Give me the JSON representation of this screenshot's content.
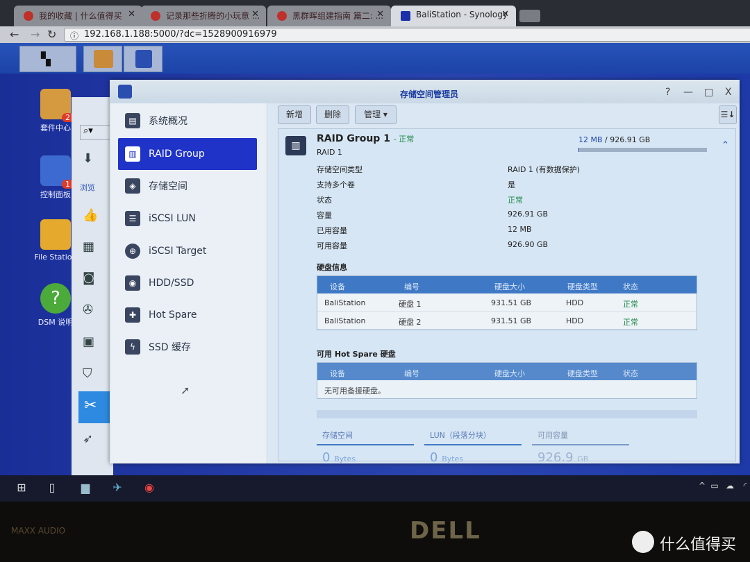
{
  "browser": {
    "tabs": [
      {
        "label": "我的收藏 | 什么值得买"
      },
      {
        "label": "记录那些折腾的小玩意 ..."
      },
      {
        "label": "黑群晖组建指南 篇二: ..."
      },
      {
        "label": "BaliStation - Synology",
        "active": true
      }
    ],
    "url": "192.168.1.188:5000/?dc=1528900916979"
  },
  "desktop": {
    "icons": [
      {
        "label": "套件中心",
        "badge": "2"
      },
      {
        "label": "控制面板",
        "badge": "1"
      },
      {
        "label": "File Station"
      },
      {
        "label": "DSM 说明"
      }
    ]
  },
  "background_window": {
    "search_icon": "search-icon",
    "label": "浏览"
  },
  "window": {
    "title": "存储空间管理员",
    "controls": [
      "?",
      "—",
      "□",
      "X"
    ],
    "sidebar": [
      {
        "label": "系统概况",
        "icon": "overview-icon"
      },
      {
        "label": "RAID Group",
        "icon": "raid-icon",
        "active": true
      },
      {
        "label": "存储空间",
        "icon": "cubes-icon"
      },
      {
        "label": "iSCSI LUN",
        "icon": "database-icon"
      },
      {
        "label": "iSCSI Target",
        "icon": "globe-icon"
      },
      {
        "label": "HDD/SSD",
        "icon": "disk-icon"
      },
      {
        "label": "Hot Spare",
        "icon": "plus-disk-icon"
      },
      {
        "label": "SSD 缓存",
        "icon": "flash-disk-icon"
      }
    ],
    "toolbar": {
      "add": "新增",
      "delete": "删除",
      "manage": "管理 ▾"
    },
    "raid": {
      "name": "RAID Group 1",
      "status_suffix": "- 正常",
      "type": "RAID 1",
      "usage_used": "12 MB",
      "usage_sep": " / ",
      "usage_total": "926.91 GB",
      "usage_fraction": 1e-05,
      "props": [
        {
          "label": "存储空间类型",
          "value": "RAID 1 (有数据保护)"
        },
        {
          "label": "支持多个卷",
          "value": "是"
        },
        {
          "label": "状态",
          "value": "正常",
          "status": true
        },
        {
          "label": "容量",
          "value": "926.91 GB"
        },
        {
          "label": "已用容量",
          "value": "12 MB"
        },
        {
          "label": "可用容量",
          "value": "926.90 GB"
        }
      ],
      "disk_section": "硬盘信息",
      "columns": [
        "设备",
        "编号",
        "硬盘大小",
        "硬盘类型",
        "状态"
      ],
      "disks": [
        {
          "device": "BaliStation",
          "number": "硬盘 1",
          "size": "931.51 GB",
          "type": "HDD",
          "status": "正常"
        },
        {
          "device": "BaliStation",
          "number": "硬盘 2",
          "size": "931.51 GB",
          "type": "HDD",
          "status": "正常"
        }
      ],
      "hotspare_section": "可用 Hot Spare 硬盘",
      "hotspare_empty": "无可用备援硬盘。",
      "summary": [
        {
          "label": "存储空间",
          "value": "0",
          "unit": "Bytes"
        },
        {
          "label": "LUN（段落分块）",
          "value": "0",
          "unit": "Bytes"
        },
        {
          "label": "可用容量",
          "value": "926.9",
          "unit": "GB"
        }
      ]
    }
  },
  "bezel": {
    "audio": "MAXX AUDIO",
    "brand": "DELL",
    "watermark": "什么值得买"
  },
  "colors": {
    "accent": "#1f33c8",
    "status_ok": "#1f8a4a",
    "table_header": "#3f79c6"
  }
}
